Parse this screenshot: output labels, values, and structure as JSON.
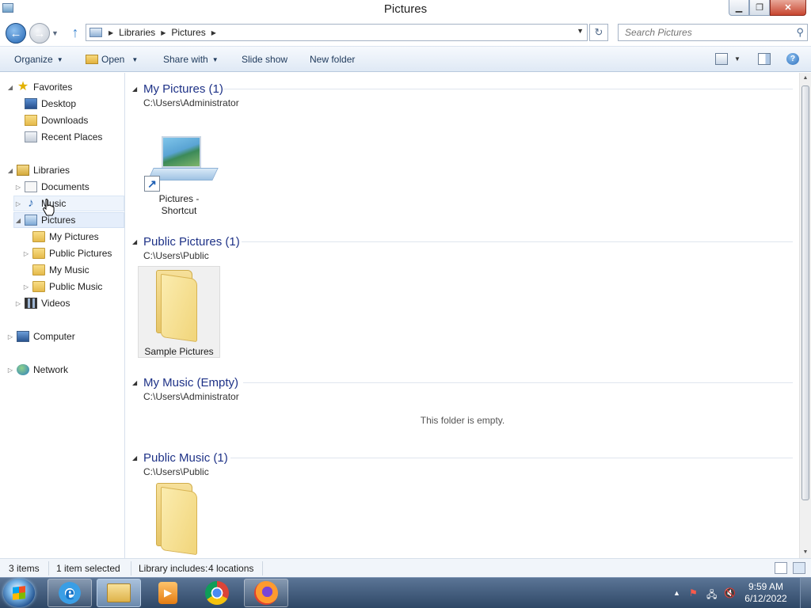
{
  "window": {
    "title": "Pictures",
    "minimize_glyph": "▁",
    "restore_glyph": "❐",
    "close_glyph": "✕"
  },
  "navigation": {
    "back_glyph": "←",
    "forward_glyph": "→",
    "history_glyph": "▼",
    "up_glyph": "↑",
    "breadcrumb": [
      "Libraries",
      "Pictures"
    ],
    "breadcrumb_sep_glyph": "▶",
    "refresh_glyph": "↻",
    "search_placeholder": "Search Pictures",
    "search_icon_glyph": "⚲"
  },
  "toolbar": {
    "organize": "Organize",
    "open": "Open",
    "share_with": "Share with",
    "slide_show": "Slide show",
    "new_folder": "New folder",
    "help_glyph": "?"
  },
  "tree": {
    "favorites": "Favorites",
    "desktop": "Desktop",
    "downloads": "Downloads",
    "recent_places": "Recent Places",
    "libraries": "Libraries",
    "documents": "Documents",
    "music": "Music",
    "pictures": "Pictures",
    "my_pictures": "My Pictures",
    "public_pictures": "Public Pictures",
    "my_music": "My Music",
    "public_music": "Public Music",
    "videos": "Videos",
    "computer": "Computer",
    "network": "Network",
    "expanded_glyph": "◢",
    "collapsed_glyph": "▷"
  },
  "groups": [
    {
      "title": "My Pictures (1)",
      "path": "C:\\Users\\Administrator",
      "items": [
        {
          "label_line1": "Pictures -",
          "label_line2": "Shortcut"
        }
      ]
    },
    {
      "title": "Public Pictures (1)",
      "path": "C:\\Users\\Public",
      "items": [
        {
          "label": "Sample Pictures"
        }
      ]
    },
    {
      "title": "My Music (Empty)",
      "path": "C:\\Users\\Administrator",
      "empty_message": "This folder is empty."
    },
    {
      "title": "Public Music (1)",
      "path": "C:\\Users\\Public"
    }
  ],
  "status": {
    "items_count": "3 items",
    "selected": "1 item selected",
    "library_includes_label": "Library includes:",
    "library_includes_value": "4 locations"
  },
  "taskbar": {
    "clock_time": "9:59 AM",
    "clock_date": "6/12/2022",
    "tray_expand_glyph": "▲",
    "wmp_glyph": "▶"
  },
  "colors": {
    "group_title": "#1e3287",
    "selection": "#e5eefb",
    "taskbar": "#2e4766"
  }
}
